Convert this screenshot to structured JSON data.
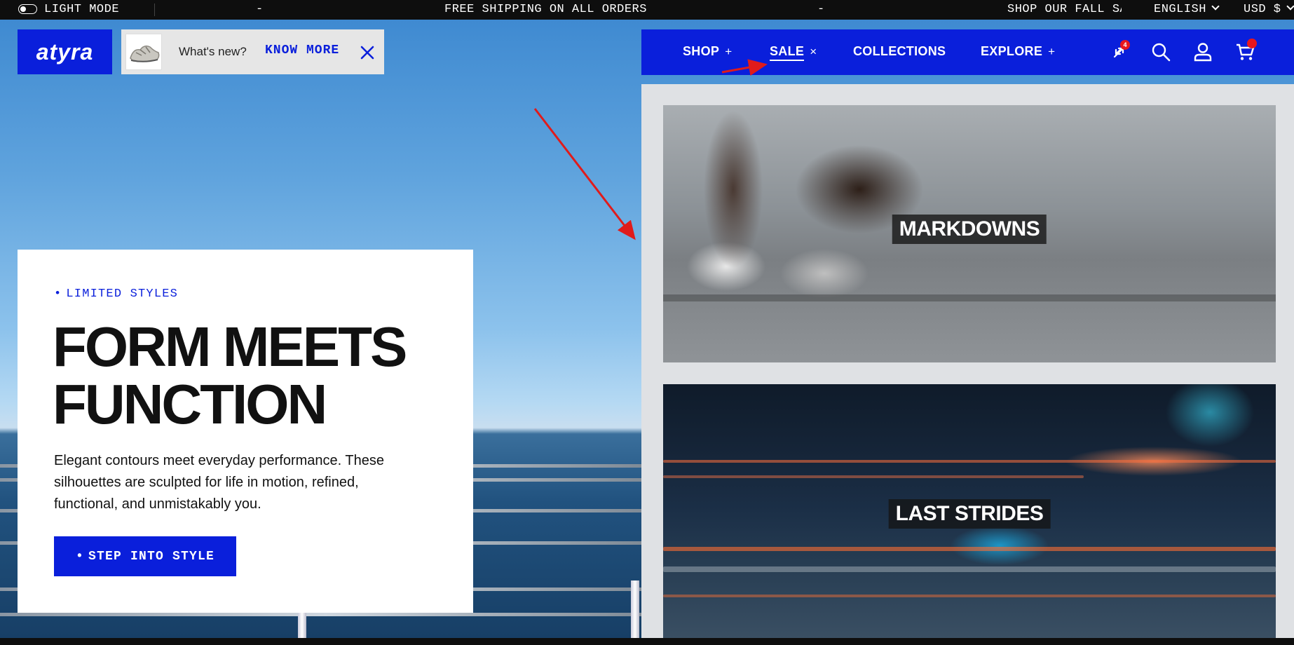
{
  "topbar": {
    "mode_label": "LIGHT MODE",
    "sep1": "-",
    "announcement": "FREE SHIPPING ON ALL ORDERS",
    "sep2": "-",
    "ticker_next": "SHOP OUR FALL SA",
    "language": "ENGLISH",
    "currency": "USD $"
  },
  "brand": {
    "logo_text": "atyra"
  },
  "notice": {
    "text": "What's new?",
    "link": "KNOW MORE"
  },
  "nav": {
    "items": [
      {
        "label": "SHOP",
        "symbol": "+"
      },
      {
        "label": "SALE",
        "symbol": "×"
      },
      {
        "label": "COLLECTIONS",
        "symbol": ""
      },
      {
        "label": "EXPLORE",
        "symbol": "+"
      }
    ],
    "compare_count": "4",
    "icons": [
      "compare-icon",
      "search-icon",
      "account-icon",
      "cart-icon"
    ]
  },
  "dropdown": {
    "tiles": [
      {
        "label": "MARKDOWNS"
      },
      {
        "label": "LAST STRIDES"
      }
    ]
  },
  "hero": {
    "eyebrow": "LIMITED STYLES",
    "headline_line1": "FORM MEETS",
    "headline_line2": "FUNCTION",
    "body": "Elegant contours meet everyday performance. These silhouettes are sculpted for life in motion, refined, functional, and unmistakably you.",
    "cta": "STEP INTO STYLE"
  },
  "colors": {
    "accent": "#0a1fdb",
    "badge": "#e8161d",
    "topbar": "#0e0e0e",
    "arrow": "#e01b1b"
  }
}
